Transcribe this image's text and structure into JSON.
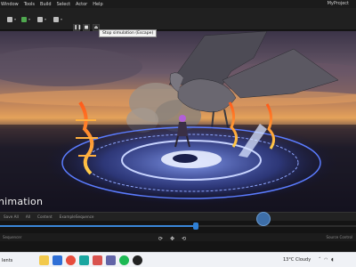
{
  "menu": {
    "items": [
      "Window",
      "Tools",
      "Build",
      "Select",
      "Actor",
      "Help"
    ],
    "project": "MyProject"
  },
  "toolbar": {
    "play_controls": [
      "pause-icon",
      "stop-icon",
      "eject-icon"
    ],
    "tooltip": "Stop simulation (Escape)"
  },
  "viewport": {
    "title_fragment": "nimation"
  },
  "sequencer": {
    "breadcrumb": [
      "Save All",
      "All",
      "Content",
      "ExampleSequence"
    ],
    "playhead_fraction": 0.55,
    "status_left": "Sequencer",
    "status_right": "Source Control"
  },
  "taskbar": {
    "date": "Ients",
    "weather": "13°C  Cloudy",
    "icons": [
      "file-explorer-icon",
      "mail-icon",
      "chrome-icon",
      "edge-icon",
      "office-icon",
      "teams-icon",
      "spotify-icon",
      "unreal-icon"
    ]
  },
  "colors": {
    "accent": "#2f80d6",
    "magic_circle": "#5b7cff",
    "fire": "#ff8a2a"
  }
}
